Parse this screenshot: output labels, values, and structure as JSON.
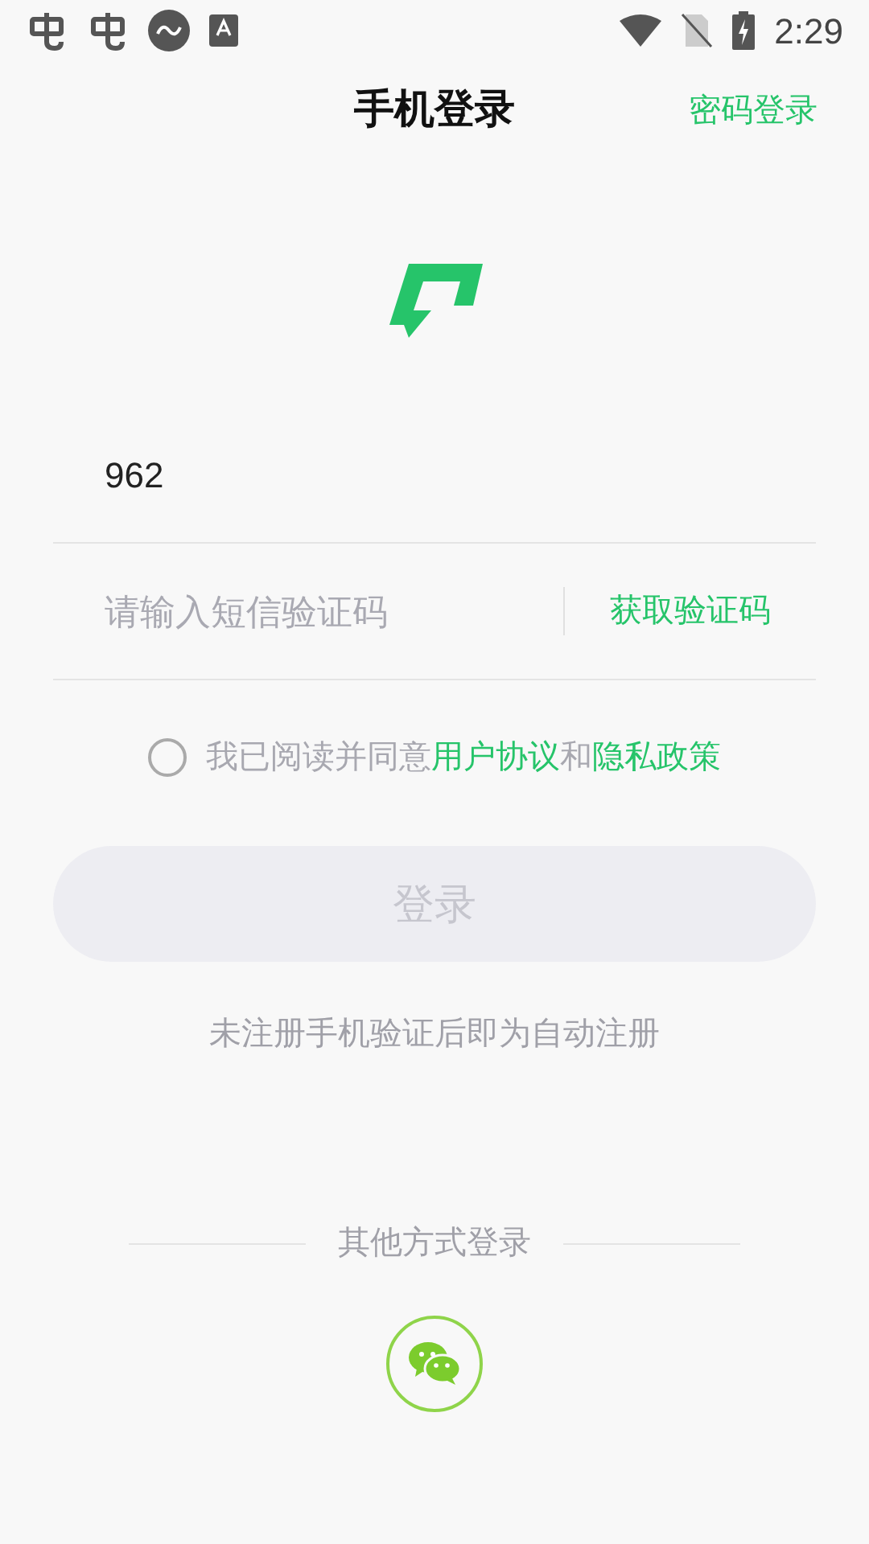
{
  "status_bar": {
    "time": "2:29"
  },
  "header": {
    "title": "手机登录",
    "action": "密码登录"
  },
  "phone_field": {
    "value": "962"
  },
  "code_field": {
    "placeholder": "请输入短信验证码",
    "button": "获取验证码"
  },
  "agreement": {
    "checked": false,
    "parts": [
      {
        "kind": "plain",
        "text": "我已阅读并同意"
      },
      {
        "kind": "link",
        "text": "用户协议"
      },
      {
        "kind": "plain",
        "text": "和"
      },
      {
        "kind": "link",
        "text": "隐私政策"
      }
    ]
  },
  "login_button": {
    "label": "登录",
    "disabled": true
  },
  "note": "未注册手机验证后即为自动注册",
  "other_login": {
    "label": "其他方式登录"
  }
}
